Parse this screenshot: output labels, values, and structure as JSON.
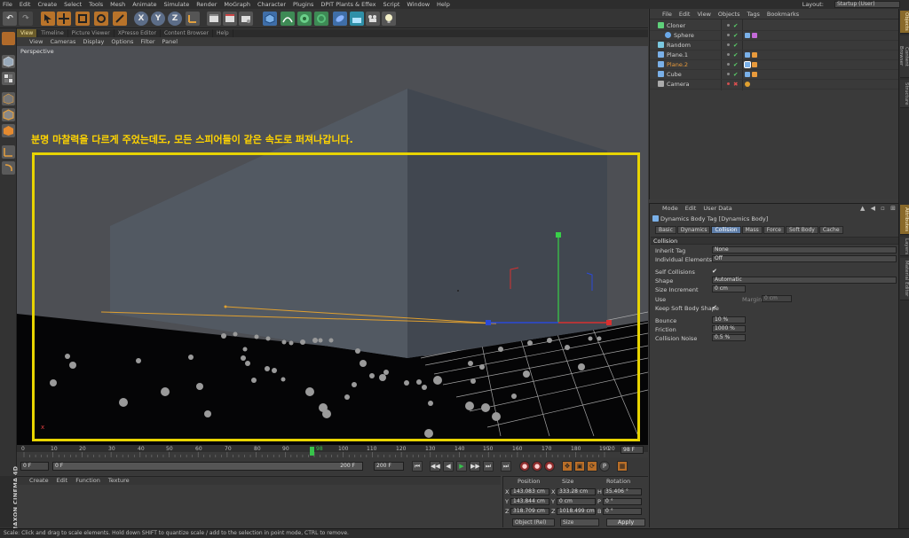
{
  "menubar": {
    "items": [
      "File",
      "Edit",
      "Create",
      "Select",
      "Tools",
      "Mesh",
      "Animate",
      "Simulate",
      "Render",
      "MoGraph",
      "Character",
      "Plugins",
      "DPIT Plants & Effex",
      "Script",
      "Window",
      "Help"
    ],
    "layout_label": "Layout:",
    "layout_value": "Startup (User)"
  },
  "toolbar": {
    "undo": "↶",
    "redo": "↷",
    "axis_x": "X",
    "axis_y": "Y",
    "axis_z": "Z"
  },
  "viewport": {
    "tabs": [
      "View",
      "Timeline",
      "Picture Viewer",
      "XPresso Editor",
      "Content Browser",
      "Help"
    ],
    "menu": [
      "View",
      "Cameras",
      "Display",
      "Options",
      "Filter",
      "Panel"
    ],
    "label": "Perspective",
    "annotation": "분명 마찰력을 다르게 주었는데도, 모든 스피어들이 같은 속도로 퍼져나갑니다.",
    "corner_axis": "x"
  },
  "timeline": {
    "ticks": [
      "0",
      "10",
      "20",
      "30",
      "40",
      "50",
      "60",
      "70",
      "80",
      "90",
      "100",
      "110",
      "120",
      "130",
      "140",
      "150",
      "160",
      "170",
      "180",
      "190",
      "20"
    ],
    "current_marker": "98",
    "current_frame": "98 F",
    "start_field": "0 F",
    "range_start": "0 F",
    "range_end": "200 F",
    "end_field": "200 F"
  },
  "transport": {
    "buttons": [
      "⏮",
      "◀◀",
      "◀",
      "▶",
      "▶▶",
      "⏭",
      "⏭"
    ],
    "record_buttons": [
      "●",
      "●",
      "●"
    ],
    "key_buttons": [
      "✥",
      "▣",
      "⟳",
      "P",
      "▦"
    ]
  },
  "material": {
    "menu": [
      "Create",
      "Edit",
      "Function",
      "Texture"
    ],
    "brand": "MAXON CINEMA 4D"
  },
  "coords": {
    "headers": [
      "Position",
      "Size",
      "Rotation"
    ],
    "rows": [
      {
        "axis": "X",
        "pos": "143.083 cm",
        "size_axis": "X",
        "size": "333.28 cm",
        "rot_axis": "H",
        "rot": "35.406 °"
      },
      {
        "axis": "Y",
        "pos": "143.844 cm",
        "size_axis": "Y",
        "size": "0 cm",
        "rot_axis": "P",
        "rot": "0 °"
      },
      {
        "axis": "Z",
        "pos": "318.709 cm",
        "size_axis": "Z",
        "size": "1018.499 cm",
        "rot_axis": "B",
        "rot": "0 °"
      }
    ],
    "mode_select": "Object (Rel)",
    "size_select": "Size",
    "apply": "Apply"
  },
  "status": {
    "text": "Scale: Click and drag to scale elements. Hold down SHIFT to quantize scale / add to the selection in point mode, CTRL to remove."
  },
  "object_manager": {
    "menu": [
      "File",
      "Edit",
      "View",
      "Objects",
      "Tags",
      "Bookmarks"
    ],
    "objects": [
      {
        "name": "Cloner",
        "indent": 0,
        "style": "normal"
      },
      {
        "name": "Sphere",
        "indent": 1,
        "style": "normal"
      },
      {
        "name": "Random",
        "indent": 0,
        "style": "normal"
      },
      {
        "name": "Plane.1",
        "indent": 0,
        "style": "normal"
      },
      {
        "name": "Plane.2",
        "indent": 0,
        "style": "orange"
      },
      {
        "name": "Cube",
        "indent": 0,
        "style": "normal"
      },
      {
        "name": "Camera",
        "indent": 0,
        "style": "normal"
      }
    ]
  },
  "attributes": {
    "menu": [
      "Mode",
      "Edit",
      "User Data"
    ],
    "title": "Dynamics Body Tag [Dynamics Body]",
    "tabs": [
      "Basic",
      "Dynamics",
      "Collision",
      "Mass",
      "Force",
      "Soft Body",
      "Cache"
    ],
    "active_tab": "Collision",
    "section": "Collision",
    "inherit_tag_label": "Inherit Tag",
    "inherit_tag_value": "None",
    "individual_label": "Individual Elements",
    "individual_value": "Off",
    "self_collisions_label": "Self Collisions",
    "self_collisions_check": "✔",
    "shape_label": "Shape",
    "shape_value": "Automatic",
    "size_increment_label": "Size Increment",
    "size_increment_value": "0 cm",
    "use_label": "Use",
    "margin_label": "Margin",
    "margin_value": "0 cm",
    "keep_shape_label": "Keep Soft Body Shape",
    "keep_shape_check": "✔",
    "bounce_label": "Bounce",
    "bounce_value": "10 %",
    "friction_label": "Friction",
    "friction_value": "1000 %",
    "noise_label": "Collision Noise",
    "noise_value": "0.5 %"
  },
  "side_tabs": {
    "top": [
      "Objects",
      "Content Browser",
      "Structure"
    ],
    "bottom": [
      "Attributes",
      "Layers",
      "Material Editor"
    ]
  },
  "colors": {
    "annotation": "#ffd400",
    "frame": "#e8d400",
    "active_tab": "#5f7ea8"
  }
}
